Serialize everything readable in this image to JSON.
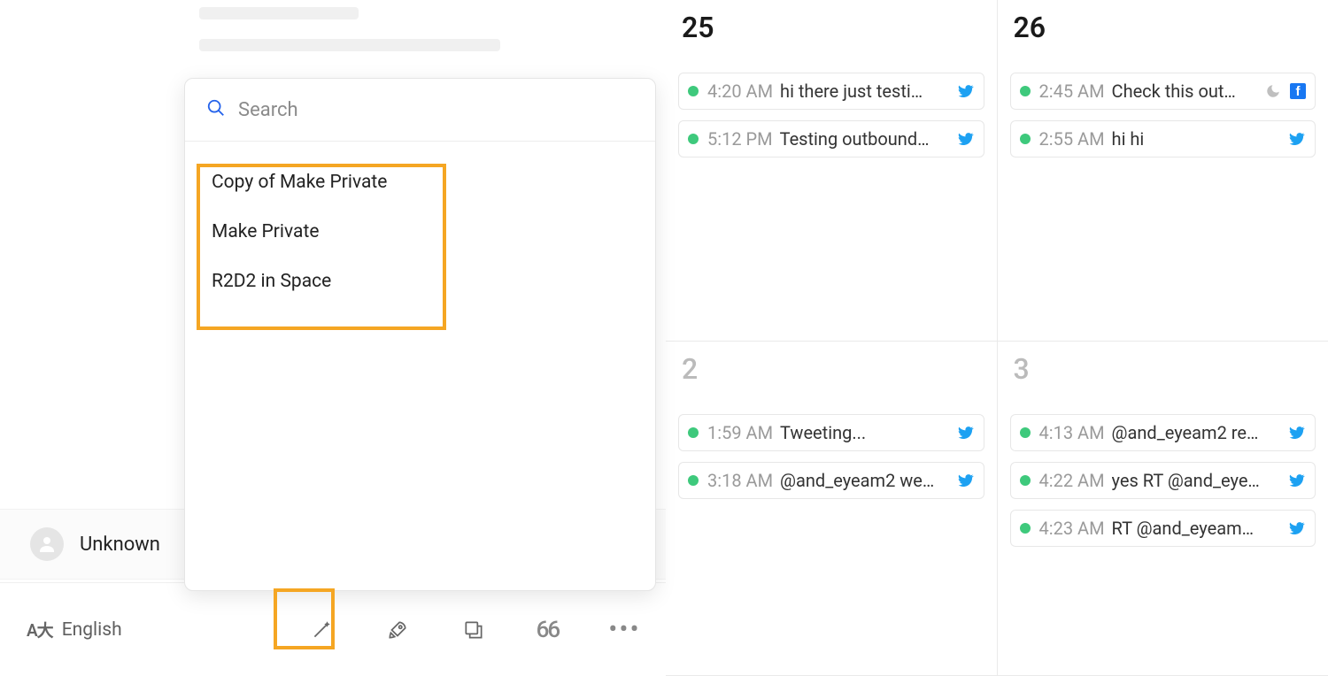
{
  "popup": {
    "search_placeholder": "Search",
    "items": [
      "Copy of Make Private",
      "Make Private",
      "R2D2 in Space"
    ]
  },
  "user": {
    "name": "Unknown"
  },
  "toolbar": {
    "language": "English"
  },
  "calendar": {
    "cols": [
      {
        "upper": {
          "num": "25",
          "current": true,
          "events": [
            {
              "time": "4:20 AM",
              "text": "hi there just testi…",
              "icons": [
                "twitter"
              ]
            },
            {
              "time": "5:12 PM",
              "text": "Testing outbound…",
              "icons": [
                "twitter"
              ]
            }
          ]
        },
        "lower": {
          "num": "2",
          "current": false,
          "events": [
            {
              "time": "1:59 AM",
              "text": "Tweeting...",
              "icons": [
                "twitter"
              ]
            },
            {
              "time": "3:18 AM",
              "text": "@and_eyeam2 we…",
              "icons": [
                "twitter"
              ]
            }
          ]
        }
      },
      {
        "upper": {
          "num": "26",
          "current": true,
          "events": [
            {
              "time": "2:45 AM",
              "text": "Check this out…",
              "icons": [
                "moon",
                "facebook"
              ]
            },
            {
              "time": "2:55 AM",
              "text": "hi hi",
              "icons": [
                "twitter"
              ]
            }
          ]
        },
        "lower": {
          "num": "3",
          "current": false,
          "events": [
            {
              "time": "4:13 AM",
              "text": "@and_eyeam2 re…",
              "icons": [
                "twitter"
              ]
            },
            {
              "time": "4:22 AM",
              "text": "yes RT @and_eye…",
              "icons": [
                "twitter"
              ]
            },
            {
              "time": "4:23 AM",
              "text": "RT @and_eyeam…",
              "icons": [
                "twitter"
              ]
            }
          ]
        }
      }
    ]
  }
}
